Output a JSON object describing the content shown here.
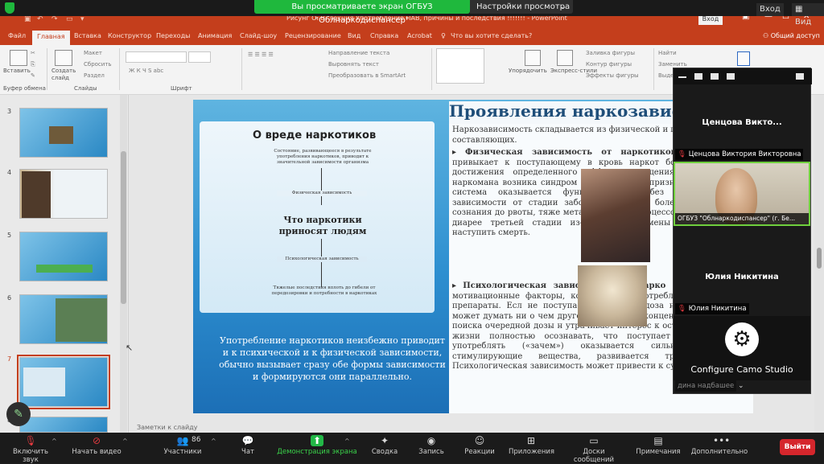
{
  "zoom_banner": {
    "sharing_text": "Вы просматриваете экран ОГБУЗ \"Облнаркодиспансер\"",
    "view_settings": "Настройки просмотра",
    "view_label": "Вход",
    "view_right": "Вид"
  },
  "ppt": {
    "title": "Рисунг О. В. лекция Употребление ПАВ, причины и последствия  !!!!!!!  -  PowerPoint",
    "signin": "Вход",
    "tabs": [
      "Файл",
      "Главная",
      "Вставка",
      "Конструктор",
      "Переходы",
      "Анимация",
      "Слайд-шоу",
      "Рецензирование",
      "Вид",
      "Справка",
      "Acrobat",
      "Что вы хотите сделать?"
    ],
    "share": "Общий доступ",
    "ribbon": {
      "paste": "Вставить",
      "create_slide": "Создать слайд",
      "clipboard": "Буфер обмена",
      "slides": "Слайды",
      "font": "Шрифт",
      "layout": "Макет",
      "reset": "Сбросить",
      "section": "Раздел",
      "text_direction": "Направление текста",
      "align_text": "Выровнять текст",
      "smartart": "Преобразовать в SmartArt",
      "arrange": "Упорядочить",
      "quick_styles": "Экспресс-стили",
      "fill": "Заливка фигуры",
      "outline": "Контур фигуры",
      "effects": "Эффекты фигуры",
      "find": "Найти",
      "replace": "Заменить",
      "select": "Выделить"
    },
    "thumb_numbers": [
      "3",
      "4",
      "5",
      "6",
      "7",
      "8"
    ],
    "notes": "Заметки к слайду"
  },
  "slide": {
    "title": "Проявления наркозависим",
    "intro": "Наркозависимость складывается из физической и психо составляющих.",
    "bullet1_head": "Физическая зависимость от наркотиков про",
    "bullet1_body": "организм привыкает к поступающему в кровь наркот большей дозы для достижения определенного эффе прекращения потребления у наркомана возника синдром («ломка»). Это признак того, что цент система оказывается функционировать без дош отмены в зависимости от стадии заболевания варьи болей и спутанности сознания до рвоты, тяже метаболических процессов, несвоемчаемой диарее третьей стадии из-за резкой отмены употребления с наступить смерть.",
    "bullet2_head": "Психологическая зависимость от нарко",
    "bullet2_body": "эмоциональные и мотивационные факторы, кот желание употреблять запрещенные препараты. Есл не поступает привычная доза наркотика, больно может думать ни о чем другом. Все его ми концентрируются вокруг поиска очередной дозы н утрачивает интерес к остальным аспектам жизни полностью осознавать, что поступает неправильно. и употреблять («зачем») оказывается сильнее. Если во стимулирующие вещества, развивается трево депрессия. Психологическая зависимость может привести к суициду.",
    "card_title": "О вреде наркотиков",
    "card_top": "Состояние, развивающееся в результате употребления наркотиков, приводит к значительной зависимости организма",
    "card_phys": "Физическая зависимость",
    "card_center": "Что наркотики приносят людям",
    "card_psych": "Психологическая зависимость",
    "card_bottom": "Тяжелые последствия вплоть до гибели от передозировки и потребности в наркотиках",
    "footer": "Употребление наркотиков неизбежно приводит и к психической и к физической зависимости, обычно вызывает сразу обе формы зависимости и формируются они параллельно."
  },
  "gallery": {
    "p1_name_big": "Ценцова Викто...",
    "p1_tag": "Ценцова Виктория Викторовна",
    "host_tag": "ОГБУЗ \"Облнаркодиспансер\" (г. Бе...",
    "p2_name_big": "Юлия Никитина",
    "p2_tag": "Юлия Никитина",
    "camo": "Configure Camo Studio",
    "camo_tag": "дина надбашее"
  },
  "zoom_bar": {
    "mute": "Включить звук",
    "video": "Начать видео",
    "participants": "Участники",
    "participants_count": "86",
    "chat": "Чат",
    "share": "Демонстрация экрана",
    "summary": "Сводка",
    "record": "Запись",
    "reactions": "Реакции",
    "apps": "Приложения",
    "whiteboards": "Доски сообщений",
    "notes": "Примечания",
    "more": "Дополнительно",
    "leave": "Выйти"
  },
  "colors": {
    "ppt_red": "#c43e1c",
    "zoom_green": "#1fb83d",
    "leave_red": "#d5262c"
  }
}
